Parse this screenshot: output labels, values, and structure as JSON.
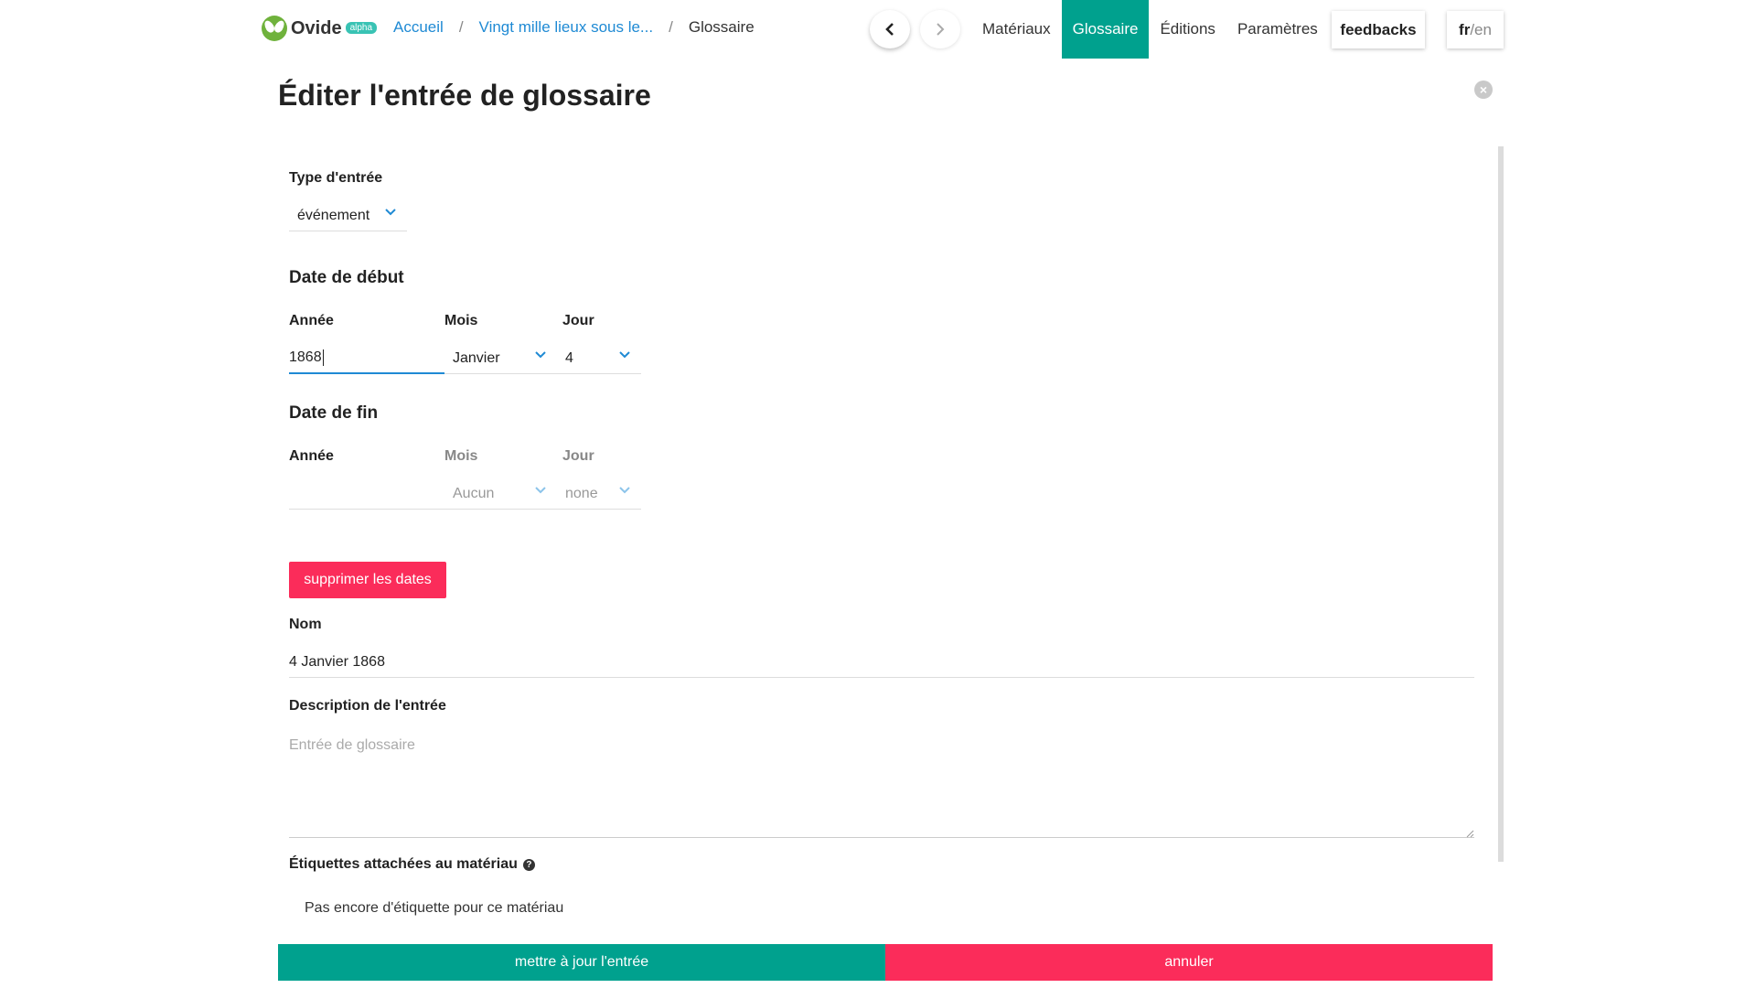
{
  "app": {
    "name": "Ovide",
    "badge": "alpha"
  },
  "breadcrumb": {
    "home": "Accueil",
    "story": "Vingt mille lieux sous le...",
    "current": "Glossaire"
  },
  "tabs": [
    "Matériaux",
    "Glossaire",
    "Éditions",
    "Paramètres"
  ],
  "active_tab": "Glossaire",
  "header_buttons": {
    "feedback": "feedbacks",
    "lang_fr": "fr",
    "lang_sep": "/",
    "lang_en": "en"
  },
  "modal": {
    "title": "Éditer l'entrée de glossaire",
    "type_label": "Type d'entrée",
    "type_value": "événement",
    "start_date": {
      "heading": "Date de début",
      "year_label": "Année",
      "month_label": "Mois",
      "day_label": "Jour",
      "year_value": "1868",
      "month_value": "Janvier",
      "day_value": "4"
    },
    "end_date": {
      "heading": "Date de fin",
      "year_label": "Année",
      "month_label": "Mois",
      "day_label": "Jour",
      "year_value": "",
      "month_value": "Aucun",
      "day_value": "none"
    },
    "delete_dates_button": "supprimer les dates",
    "name_label": "Nom",
    "name_value": "4 Janvier 1868",
    "description_label": "Description de l'entrée",
    "description_placeholder": "Entrée de glossaire",
    "tags_label": "Étiquettes attachées au matériau",
    "tags_empty": "Pas encore d'étiquette pour ce matériau",
    "update_button": "mettre à jour l'entrée",
    "cancel_button": "annuler"
  },
  "colors": {
    "accent": "#00a18e",
    "danger": "#fb2c5a",
    "link": "#1f8ad4",
    "logo": "#6fb23c"
  }
}
